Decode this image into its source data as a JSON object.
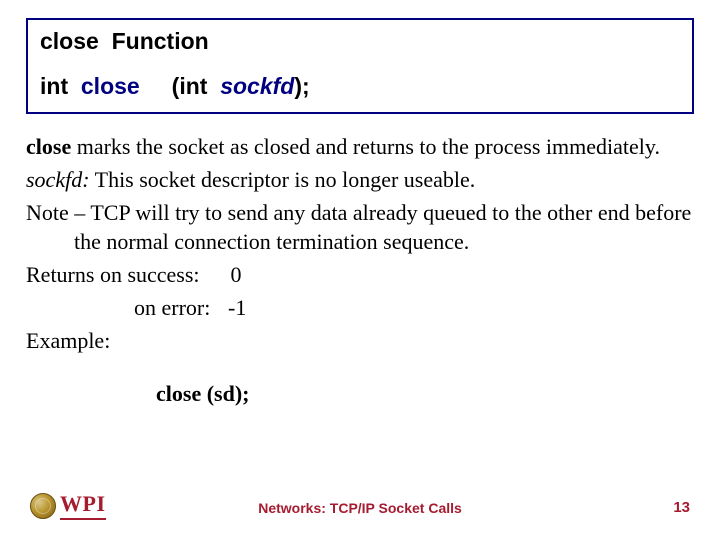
{
  "box": {
    "title_word1": "close",
    "title_word2": "Function",
    "sig_ret": "int",
    "sig_name": "close",
    "sig_paren_open": "(int",
    "sig_arg": "sockfd",
    "sig_paren_close": ");"
  },
  "body": {
    "p1_fn": "close",
    "p1_rest": " marks the socket as closed and returns to the process immediately.",
    "p2_arg": "sockfd:",
    "p2_rest": "  This socket descriptor is no longer useable.",
    "p3": "Note – TCP will try to send any data already queued to the other end before the normal connection termination sequence.",
    "ret_label": "Returns",
    "ret_success": " on success:",
    "ret_success_val": "0",
    "ret_error": "on error:",
    "ret_error_val": "-1",
    "example_label": "Example:",
    "example_code": "close (sd);"
  },
  "footer": {
    "logo_text": "WPI",
    "title": "Networks: TCP/IP Socket Calls",
    "page": "13"
  }
}
